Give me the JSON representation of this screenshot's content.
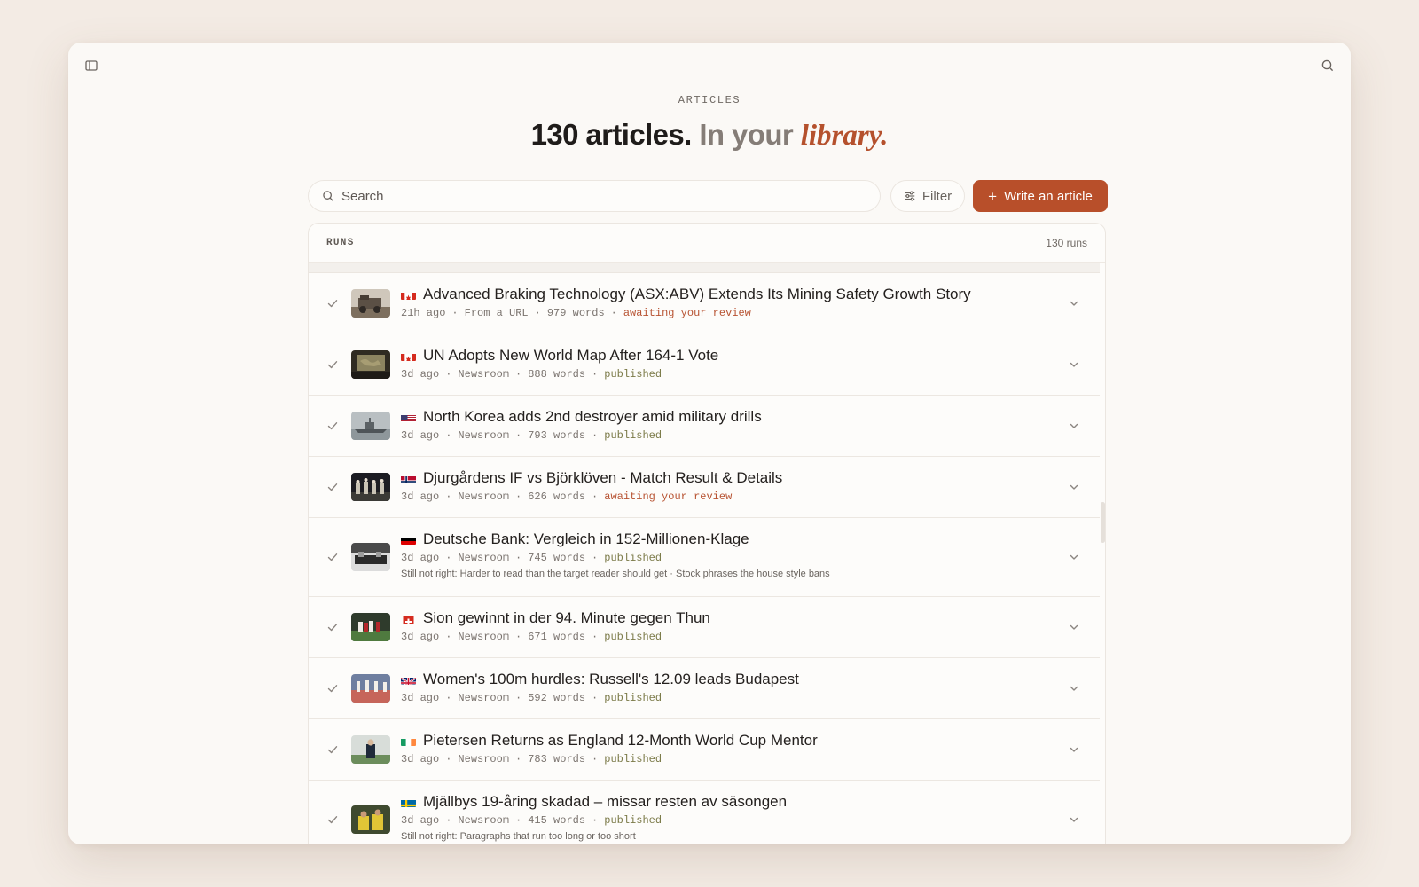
{
  "page": {
    "eyebrow": "ARTICLES",
    "headline_main": "130 articles.",
    "headline_muted": "In your",
    "headline_accent": "library."
  },
  "toolbar": {
    "search_placeholder": "Search",
    "filter_label": "Filter",
    "write_label": "Write an article"
  },
  "runs": {
    "title": "RUNS",
    "count": "130 runs",
    "items": [
      {
        "flag": "Canada",
        "title": "Advanced Braking Technology (ASX:ABV) Extends Its Mining Safety Growth Story",
        "time": "21h ago",
        "source": "From a URL",
        "words": "979 words",
        "status": "awaiting your review",
        "status_kind": "review",
        "note": ""
      },
      {
        "flag": "Canada",
        "title": "UN Adopts New World Map After 164-1 Vote",
        "time": "3d ago",
        "source": "Newsroom",
        "words": "888 words",
        "status": "published",
        "status_kind": "published",
        "note": ""
      },
      {
        "flag": "United States",
        "title": "North Korea adds 2nd destroyer amid military drills",
        "time": "3d ago",
        "source": "Newsroom",
        "words": "793 words",
        "status": "published",
        "status_kind": "published",
        "note": ""
      },
      {
        "flag": "Norway",
        "title": "Djurgårdens IF vs Björklöven - Match Result & Details",
        "time": "3d ago",
        "source": "Newsroom",
        "words": "626 words",
        "status": "awaiting your review",
        "status_kind": "review",
        "note": ""
      },
      {
        "flag": "Germany",
        "title": "Deutsche Bank: Vergleich in 152-Millionen-Klage",
        "time": "3d ago",
        "source": "Newsroom",
        "words": "745 words",
        "status": "published",
        "status_kind": "published",
        "note": "Still not right: Harder to read than the target reader should get · Stock phrases the house style bans"
      },
      {
        "flag": "Switzerland",
        "title": "Sion gewinnt in der 94. Minute gegen Thun",
        "time": "3d ago",
        "source": "Newsroom",
        "words": "671 words",
        "status": "published",
        "status_kind": "published",
        "note": ""
      },
      {
        "flag": "United Kingdom",
        "title": "Women's 100m hurdles: Russell's 12.09 leads Budapest",
        "time": "3d ago",
        "source": "Newsroom",
        "words": "592 words",
        "status": "published",
        "status_kind": "published",
        "note": ""
      },
      {
        "flag": "Ireland",
        "title": "Pietersen Returns as England 12-Month World Cup Mentor",
        "time": "3d ago",
        "source": "Newsroom",
        "words": "783 words",
        "status": "published",
        "status_kind": "published",
        "note": ""
      },
      {
        "flag": "Sweden",
        "title": "Mjällbys 19-åring skadad – missar resten av säsongen",
        "time": "3d ago",
        "source": "Newsroom",
        "words": "415 words",
        "status": "published",
        "status_kind": "published",
        "note": "Still not right: Paragraphs that run too long or too short"
      }
    ]
  },
  "colors": {
    "accent": "#b84f2a",
    "review": "#b75231",
    "published": "#7b7a48",
    "background": "#f3ebe4"
  },
  "icons": {
    "sidebar_toggle": "sidebar-panel-icon",
    "search": "search-icon",
    "filter": "sliders-icon",
    "check": "check-icon",
    "expand": "chevron-down-icon"
  }
}
